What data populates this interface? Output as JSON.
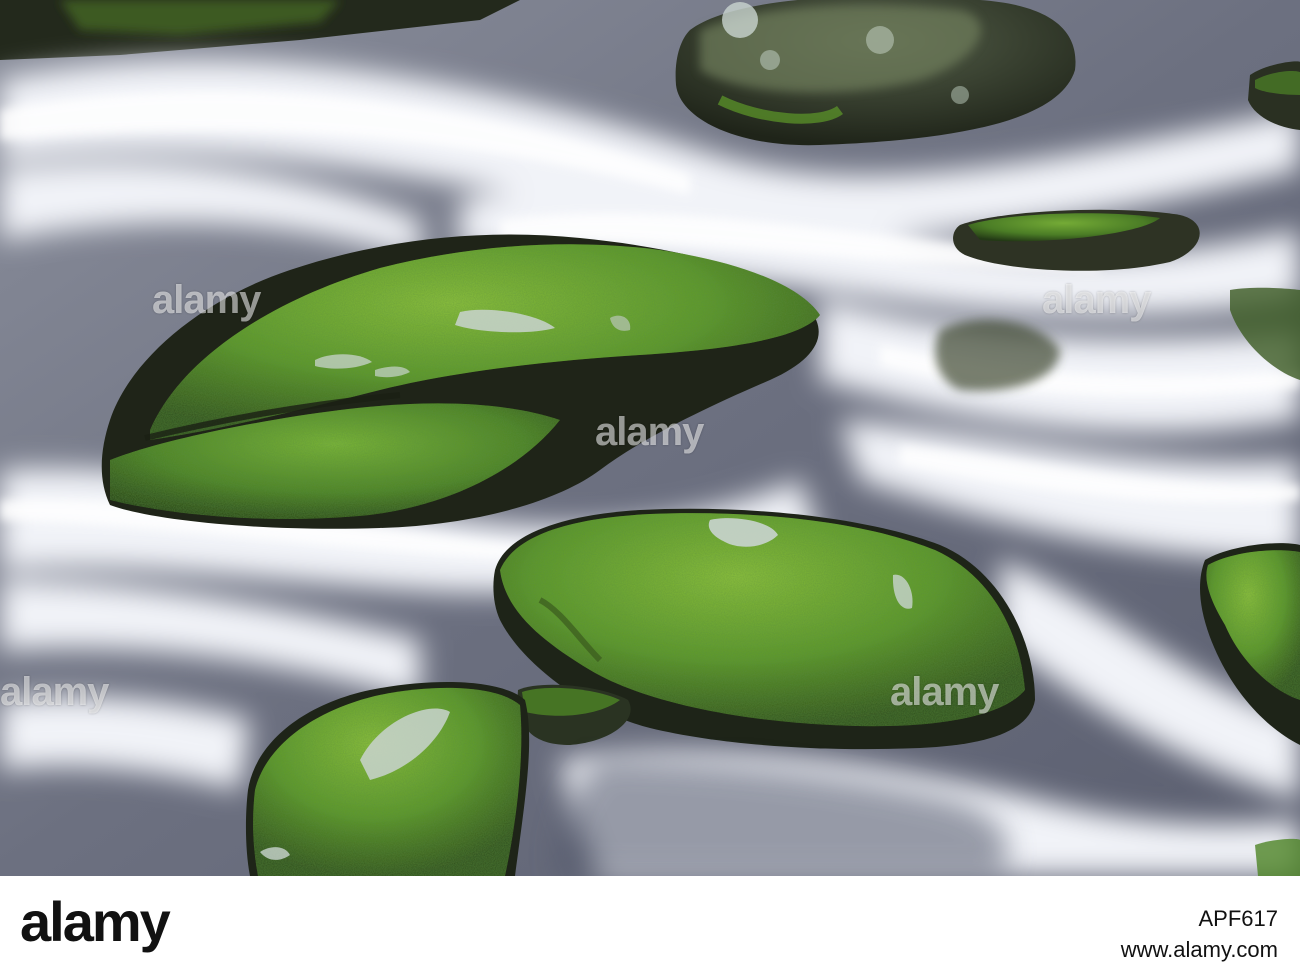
{
  "photo": {
    "subject": "moss-covered-rocks-in-flowing-stream",
    "watermark_text": "alamy",
    "colors": {
      "moss": "#5e9a2a",
      "moss_highlight": "#8cc23c",
      "rock": "#2e3324",
      "water": "#eef0f6",
      "water_shadow": "#7e8494",
      "lichen": "#c9d4cf"
    }
  },
  "footer": {
    "logo_text": "alamy",
    "site_text": "www.alamy.com",
    "image_id": "APF617"
  }
}
